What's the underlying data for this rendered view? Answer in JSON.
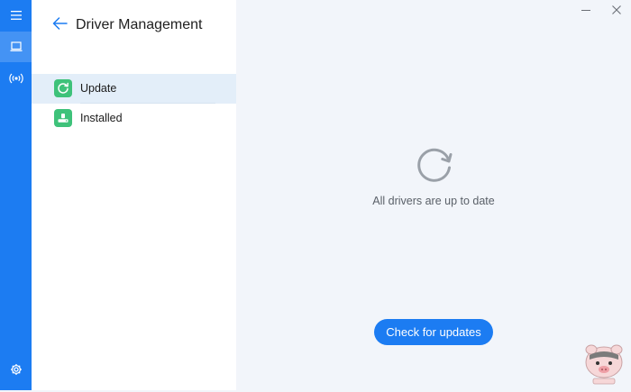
{
  "rail": {
    "items": [
      {
        "icon": "menu-icon"
      },
      {
        "icon": "laptop-icon",
        "active": true
      },
      {
        "icon": "broadcast-icon"
      },
      {
        "icon": "gear-icon"
      }
    ],
    "accent": "#1c7cf2"
  },
  "header": {
    "title": "Driver Management",
    "back_icon": "back-arrow-icon"
  },
  "nav": {
    "items": [
      {
        "label": "Update",
        "icon": "refresh-icon",
        "selected": true
      },
      {
        "label": "Installed",
        "icon": "drive-icon",
        "selected": false
      }
    ],
    "tile_color": "#3ec27a"
  },
  "window": {
    "controls": [
      "minimize-icon",
      "close-icon"
    ]
  },
  "main": {
    "status_icon": "refresh-circle-icon",
    "status_text": "All drivers are up to date",
    "check_button_label": "Check for updates"
  }
}
